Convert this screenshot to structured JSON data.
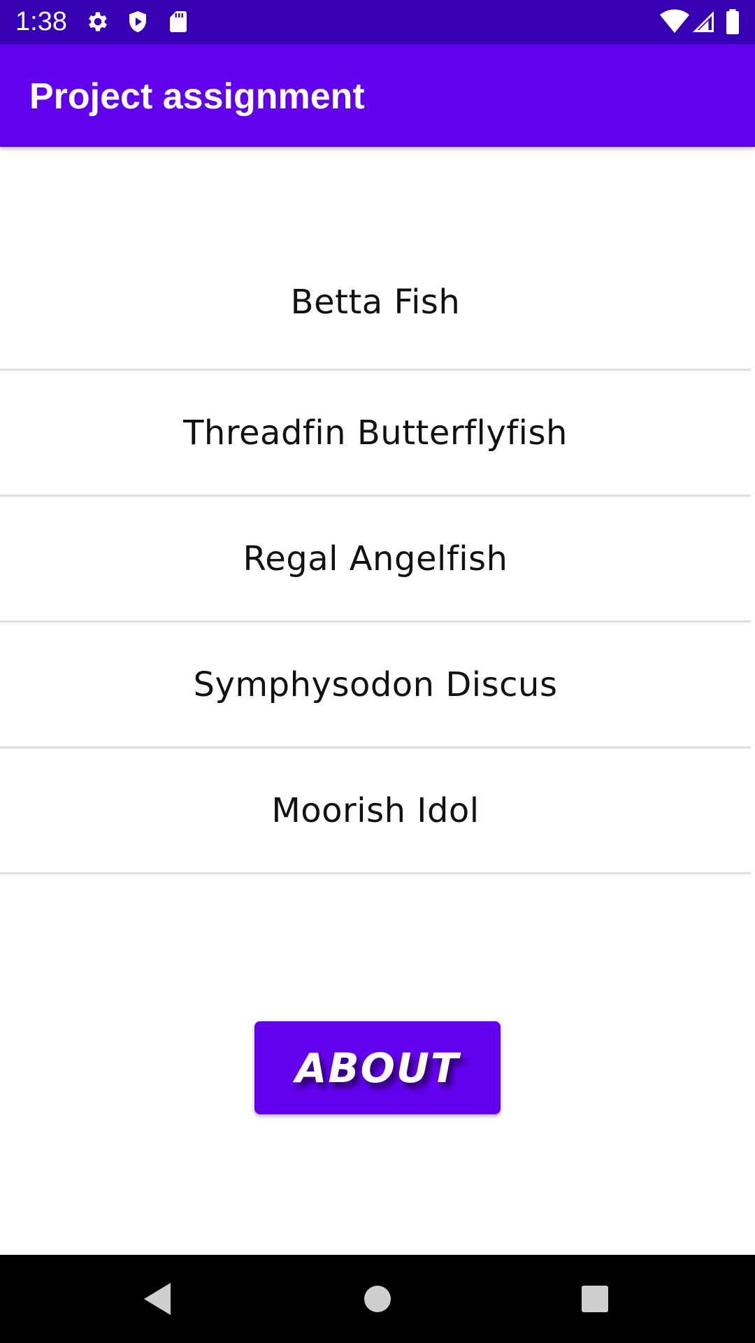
{
  "status_bar": {
    "time": "1:38",
    "left_icons": [
      "gear-icon",
      "shield-play-icon",
      "sd-card-icon"
    ],
    "right_icons": [
      "wifi-icon",
      "signal-icon",
      "battery-icon"
    ]
  },
  "app_bar": {
    "title": "Project assignment"
  },
  "fish_list": {
    "items": [
      {
        "label": "Betta Fish"
      },
      {
        "label": "Threadfin Butterflyfish"
      },
      {
        "label": "Regal Angelfish"
      },
      {
        "label": "Symphysodon Discus"
      },
      {
        "label": "Moorish Idol"
      }
    ]
  },
  "about_button": {
    "label": "ABOUT"
  },
  "nav_bar": {
    "buttons": [
      "back-icon",
      "home-icon",
      "recents-icon"
    ]
  },
  "colors": {
    "status_bar": "#3700b3",
    "primary": "#6200ee",
    "divider": "#dedede",
    "nav_bar": "#000000"
  }
}
